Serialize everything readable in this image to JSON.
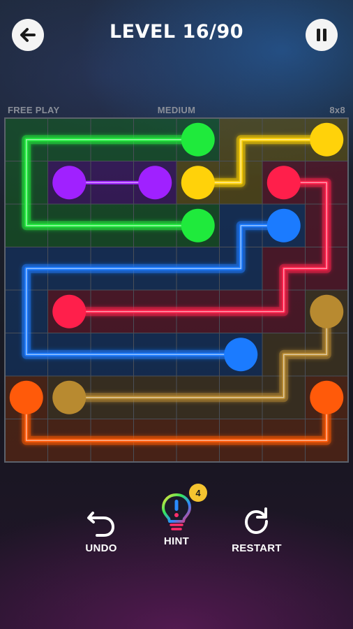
{
  "header": {
    "title": "LEVEL 16/90",
    "back_icon": "arrow-left-icon",
    "pause_icon": "pause-icon"
  },
  "board_info": {
    "mode": "FREE PLAY",
    "difficulty": "MEDIUM",
    "size": "8x8"
  },
  "board": {
    "cols": 8,
    "rows": 8,
    "paths": [
      {
        "name": "green",
        "color": "#1fea3c",
        "cells": [
          [
            4,
            0
          ],
          [
            3,
            0
          ],
          [
            2,
            0
          ],
          [
            1,
            0
          ],
          [
            0,
            0
          ],
          [
            0,
            1
          ],
          [
            0,
            2
          ],
          [
            1,
            2
          ],
          [
            2,
            2
          ],
          [
            3,
            2
          ],
          [
            4,
            2
          ]
        ]
      },
      {
        "name": "purple",
        "color": "#a021ff",
        "cells": [
          [
            1,
            1
          ],
          [
            2,
            1
          ],
          [
            3,
            1
          ]
        ]
      },
      {
        "name": "yellow",
        "color": "#ffd20a",
        "cells": [
          [
            7,
            0
          ],
          [
            6,
            0
          ],
          [
            5,
            0
          ],
          [
            5,
            1
          ],
          [
            4,
            1
          ]
        ]
      },
      {
        "name": "red",
        "color": "#ff1f4b",
        "cells": [
          [
            6,
            1
          ],
          [
            7,
            1
          ],
          [
            7,
            2
          ],
          [
            7,
            3
          ],
          [
            6,
            3
          ],
          [
            6,
            4
          ],
          [
            5,
            4
          ],
          [
            4,
            4
          ],
          [
            3,
            4
          ],
          [
            2,
            4
          ],
          [
            1,
            4
          ]
        ]
      },
      {
        "name": "blue",
        "color": "#1b7bff",
        "cells": [
          [
            6,
            2
          ],
          [
            5,
            2
          ],
          [
            5,
            3
          ],
          [
            4,
            3
          ],
          [
            3,
            3
          ],
          [
            2,
            3
          ],
          [
            1,
            3
          ],
          [
            0,
            3
          ],
          [
            0,
            4
          ],
          [
            0,
            5
          ],
          [
            1,
            5
          ],
          [
            2,
            5
          ],
          [
            3,
            5
          ],
          [
            4,
            5
          ],
          [
            5,
            5
          ]
        ]
      },
      {
        "name": "gold",
        "color": "#b88a30",
        "cells": [
          [
            7,
            4
          ],
          [
            7,
            5
          ],
          [
            6,
            5
          ],
          [
            6,
            6
          ],
          [
            5,
            6
          ],
          [
            4,
            6
          ],
          [
            3,
            6
          ],
          [
            2,
            6
          ],
          [
            1,
            6
          ]
        ]
      },
      {
        "name": "orange",
        "color": "#ff5a0a",
        "cells": [
          [
            0,
            6
          ],
          [
            0,
            7
          ],
          [
            1,
            7
          ],
          [
            2,
            7
          ],
          [
            3,
            7
          ],
          [
            4,
            7
          ],
          [
            5,
            7
          ],
          [
            6,
            7
          ],
          [
            7,
            7
          ],
          [
            7,
            6
          ]
        ]
      }
    ]
  },
  "controls": {
    "undo": {
      "label": "UNDO",
      "icon": "undo-icon"
    },
    "hint": {
      "label": "HINT",
      "icon": "lightbulb-icon",
      "badge": "4"
    },
    "restart": {
      "label": "RESTART",
      "icon": "restart-icon"
    }
  }
}
